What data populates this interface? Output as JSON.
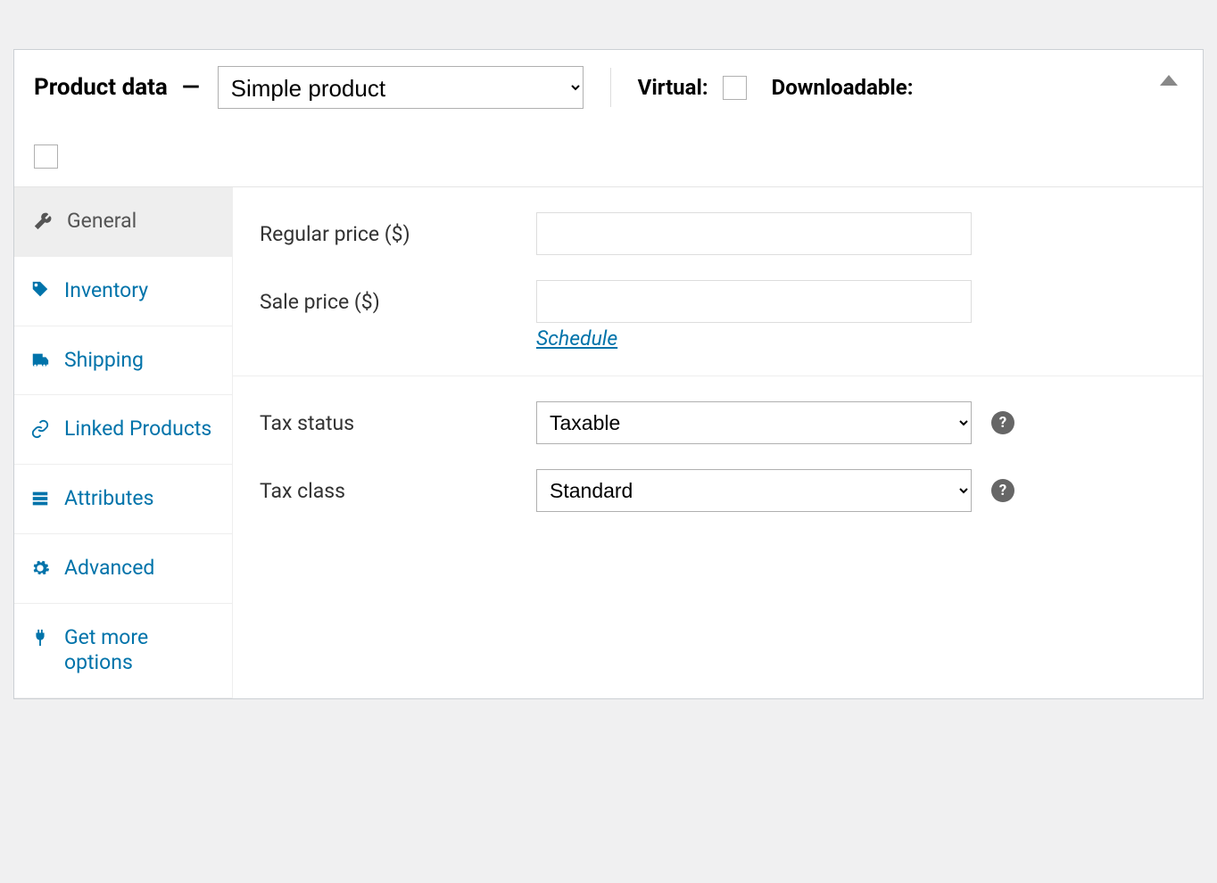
{
  "header": {
    "title": "Product data",
    "dash": "—",
    "product_type_value": "Simple product",
    "virtual_label": "Virtual:",
    "downloadable_label": "Downloadable:"
  },
  "tabs": [
    {
      "key": "general",
      "label": "General",
      "active": true
    },
    {
      "key": "inventory",
      "label": "Inventory",
      "active": false
    },
    {
      "key": "shipping",
      "label": "Shipping",
      "active": false
    },
    {
      "key": "linked",
      "label": "Linked Products",
      "active": false
    },
    {
      "key": "attributes",
      "label": "Attributes",
      "active": false
    },
    {
      "key": "advanced",
      "label": "Advanced",
      "active": false
    },
    {
      "key": "getmore",
      "label": "Get more options",
      "active": false
    }
  ],
  "fields": {
    "regular_price_label": "Regular price ($)",
    "regular_price_value": "",
    "sale_price_label": "Sale price ($)",
    "sale_price_value": "",
    "schedule_label": "Schedule",
    "tax_status_label": "Tax status",
    "tax_status_value": "Taxable",
    "tax_class_label": "Tax class",
    "tax_class_value": "Standard"
  },
  "help_glyph": "?"
}
